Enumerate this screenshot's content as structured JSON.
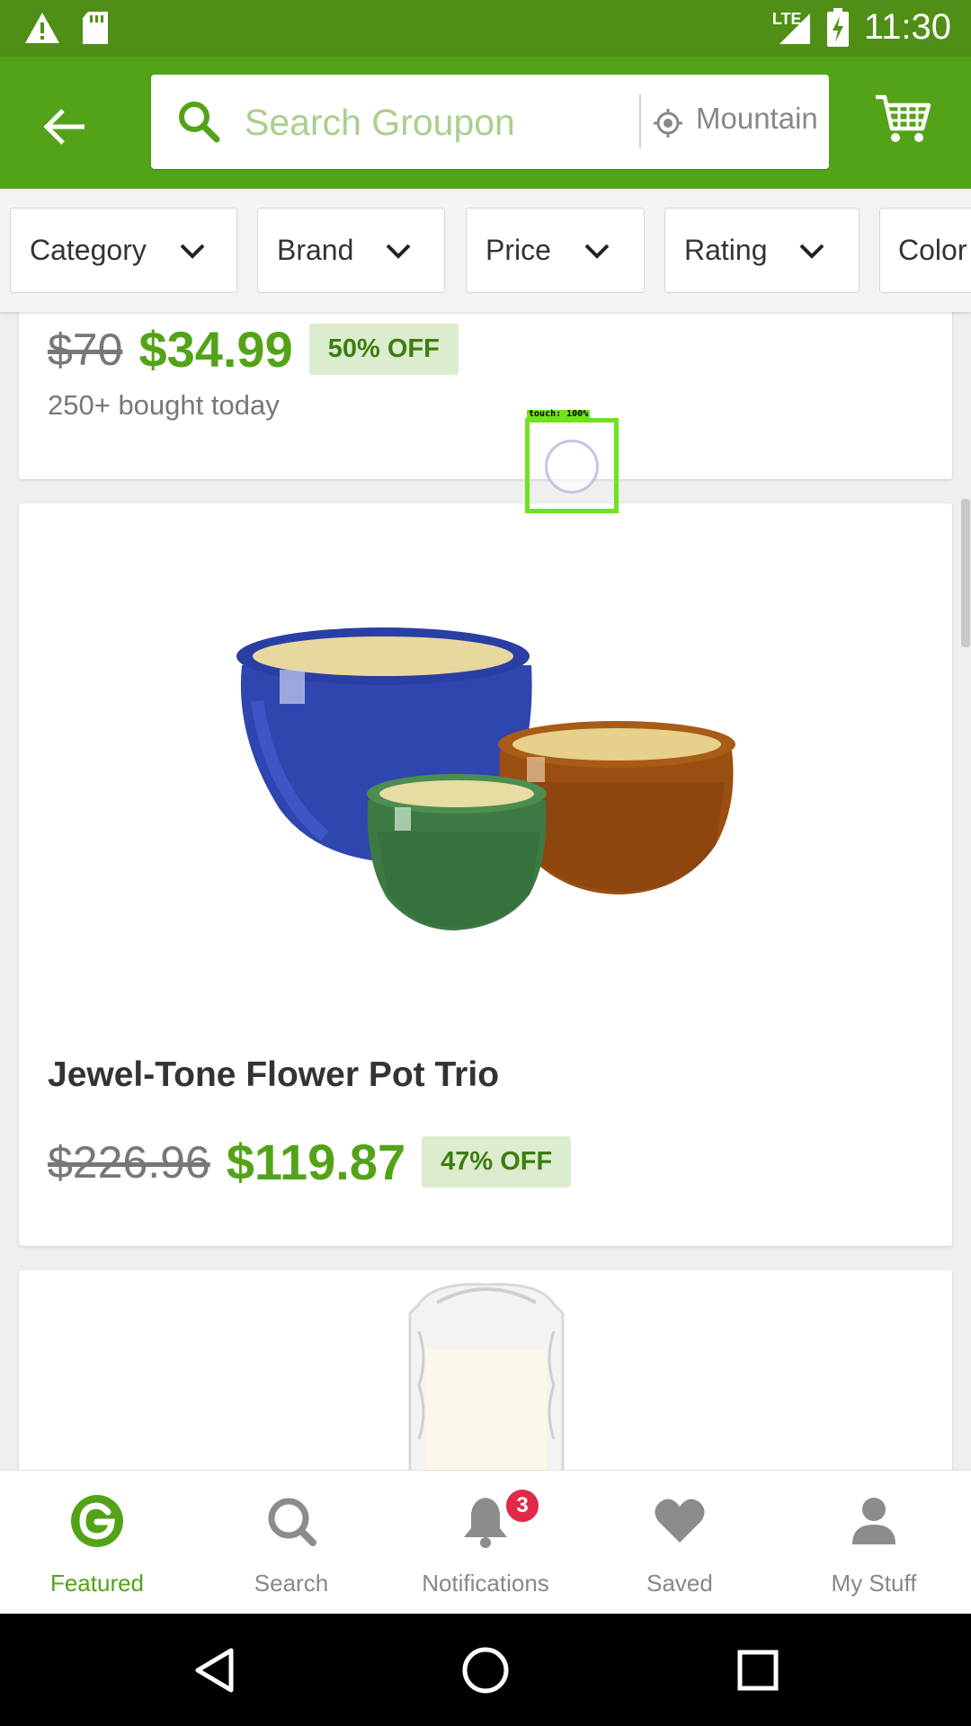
{
  "status_bar": {
    "time": "11:30",
    "network": "LTE"
  },
  "search": {
    "placeholder": "Search Groupon",
    "location": "Mountain View"
  },
  "filters": [
    {
      "label": "Category"
    },
    {
      "label": "Brand"
    },
    {
      "label": "Price"
    },
    {
      "label": "Rating"
    },
    {
      "label": "Color"
    }
  ],
  "deals": [
    {
      "original_price": "$70",
      "sale_price": "$34.99",
      "discount": "50% OFF",
      "bought": "250+ bought today"
    },
    {
      "title": "Jewel-Tone Flower Pot Trio",
      "original_price": "$226.96",
      "sale_price": "$119.87",
      "discount": "47% OFF"
    }
  ],
  "touch_indicator": {
    "label": "touch: 100%"
  },
  "bottom_nav": [
    {
      "label": "Featured",
      "icon": "groupon-g-icon",
      "active": true
    },
    {
      "label": "Search",
      "icon": "search-icon"
    },
    {
      "label": "Notifications",
      "icon": "bell-icon",
      "badge": "3"
    },
    {
      "label": "Saved",
      "icon": "heart-icon"
    },
    {
      "label": "My Stuff",
      "icon": "person-icon"
    }
  ],
  "colors": {
    "brand_green": "#53a318",
    "status_green": "#4f8f16",
    "badge_red": "#e2294a"
  }
}
